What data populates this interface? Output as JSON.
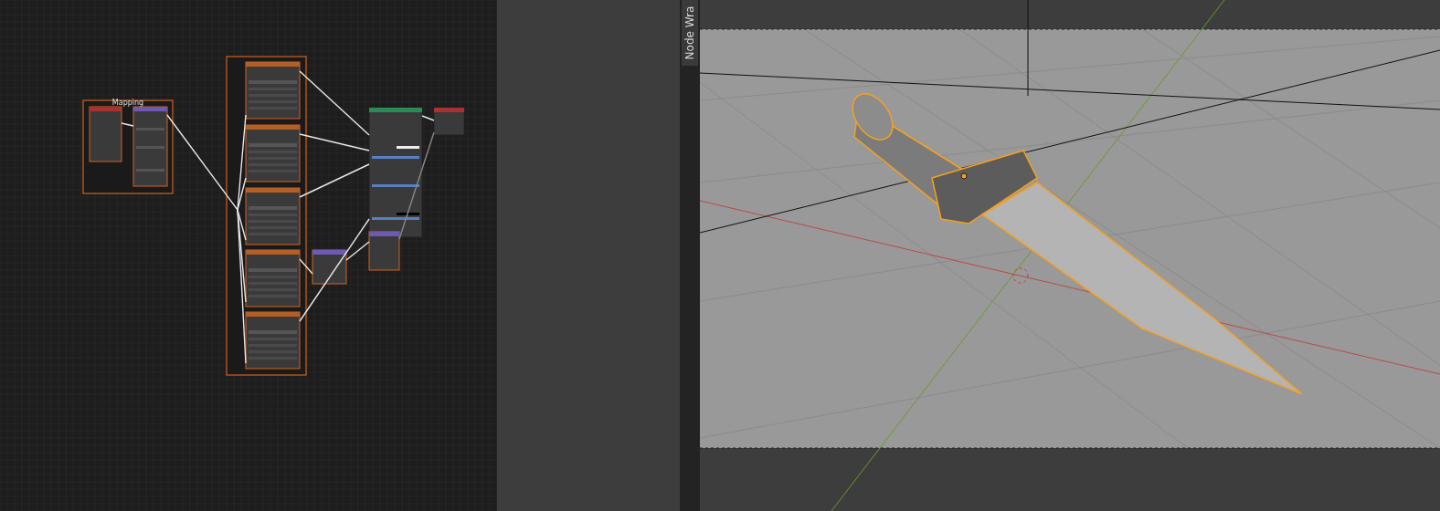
{
  "node_editor": {
    "frame_label": "Mapping"
  },
  "sidebar_tab": {
    "label": "Node Wra"
  }
}
